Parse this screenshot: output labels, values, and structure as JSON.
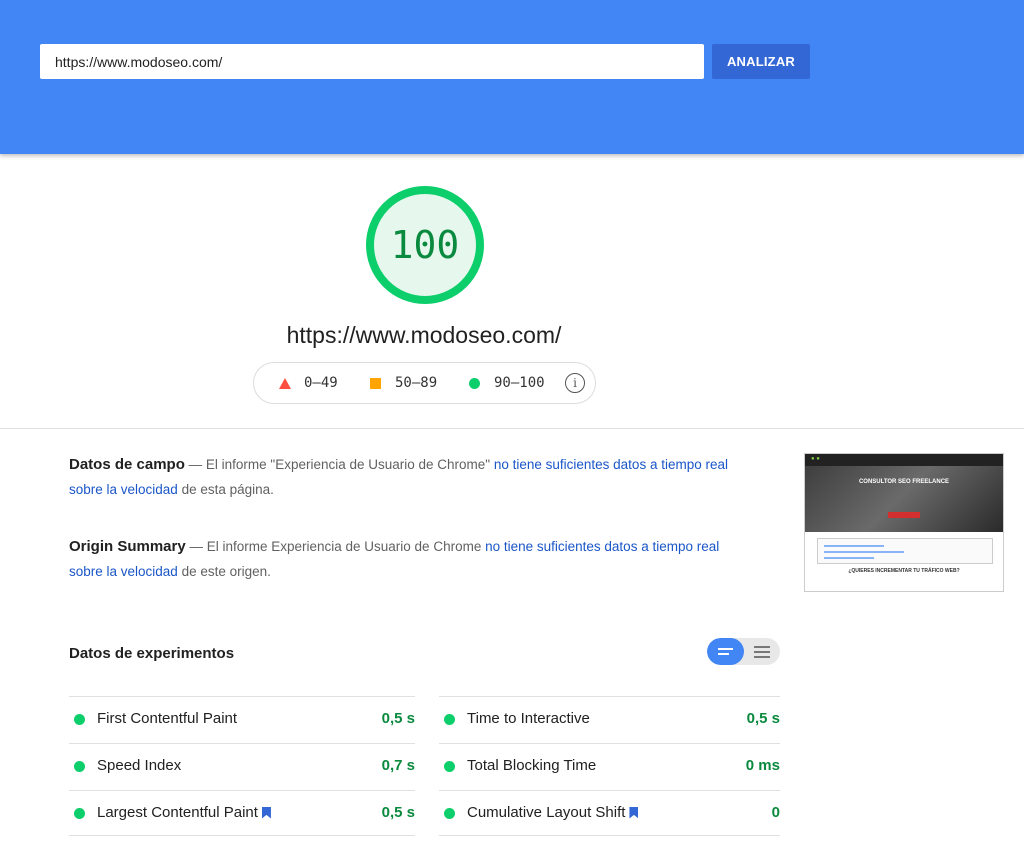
{
  "search": {
    "url_value": "https://www.modoseo.com/",
    "analyze_label": "ANALIZAR"
  },
  "score": {
    "value": "100",
    "value_fraction": 1.0,
    "color": "#0cce6b"
  },
  "final_url": "https://www.modoseo.com/",
  "legend": {
    "fail": "0–49",
    "average": "50–89",
    "pass": "90–100",
    "colors": {
      "fail": "#ff4e42",
      "average": "#ffa400",
      "pass": "#0cce6b"
    },
    "info_icon": "info-icon"
  },
  "field_data": {
    "title": "Datos de campo",
    "text_before": " — El informe \"Experiencia de Usuario de Chrome\" ",
    "link": "no tiene suficientes datos a tiempo real sobre la velocidad",
    "text_after": " de esta página."
  },
  "origin_summary": {
    "title": "Origin Summary",
    "text_before": " — El informe Experiencia de Usuario de Chrome ",
    "link": "no tiene suficientes datos a tiempo real sobre la velocidad",
    "text_after": " de este origen."
  },
  "screenshot": {
    "heading": "CONSULTOR SEO FREELANCE",
    "cta": "¿QUIERES INCREMENTAR TU TRÁFICO WEB?"
  },
  "lab_data": {
    "title": "Datos de experimentos",
    "metrics": [
      {
        "name": "First Contentful Paint",
        "value": "0,5 s",
        "bookmark": false
      },
      {
        "name": "Time to Interactive",
        "value": "0,5 s",
        "bookmark": false
      },
      {
        "name": "Speed Index",
        "value": "0,7 s",
        "bookmark": false
      },
      {
        "name": "Total Blocking Time",
        "value": "0 ms",
        "bookmark": false
      },
      {
        "name": "Largest Contentful Paint",
        "value": "0,5 s",
        "bookmark": true
      },
      {
        "name": "Cumulative Layout Shift",
        "value": "0",
        "bookmark": true
      }
    ]
  },
  "colors": {
    "header_bg": "#4285f4",
    "button_bg": "#3367d6",
    "link": "#1a56c8",
    "pass_value": "#0a8a3e"
  }
}
